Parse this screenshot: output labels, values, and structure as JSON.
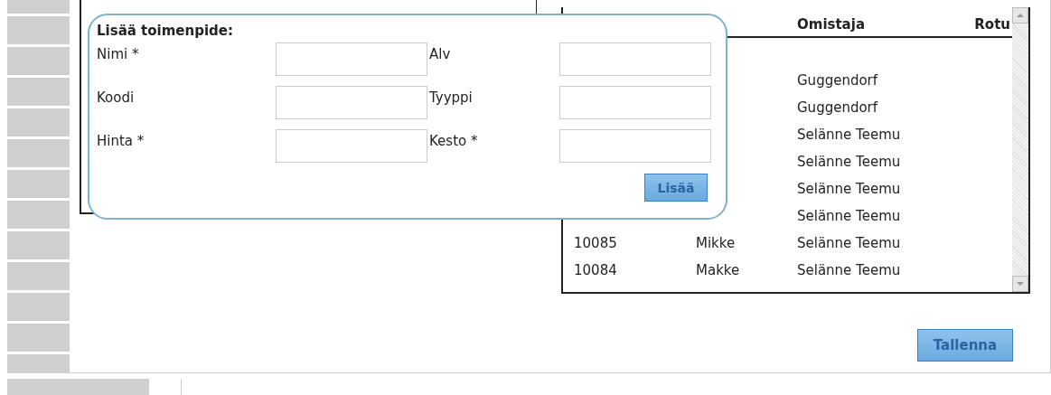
{
  "dialog": {
    "title": "Lisää toimenpide:",
    "fields": [
      {
        "label": "Nimi *"
      },
      {
        "label": "Alv"
      },
      {
        "label": "Koodi"
      },
      {
        "label": "Tyyppi"
      },
      {
        "label": "Hinta *"
      },
      {
        "label": "Kesto *"
      }
    ],
    "button": {
      "label": "Lisää",
      "disabled": true
    }
  },
  "table": {
    "columns": [
      {
        "label": "Omistaja"
      },
      {
        "label": "Rotu"
      }
    ],
    "rows": [
      {
        "column_3": "Guggendorf"
      },
      {
        "column_3": "Guggendorf"
      },
      {
        "column_3": "Selänne Teemu"
      },
      {
        "column_3": "Selänne Teemu"
      },
      {
        "column_3": "Selänne Teemu"
      },
      {
        "column_3": "Selänne Teemu"
      },
      {
        "column_1": "10085",
        "column_2": "Mikke",
        "column_3": "Selänne Teemu"
      },
      {
        "column_1": "10084",
        "column_2": "Makke",
        "column_3": "Selänne Teemu"
      }
    ]
  },
  "save_button": {
    "label": "Tallenna",
    "disabled": true
  }
}
